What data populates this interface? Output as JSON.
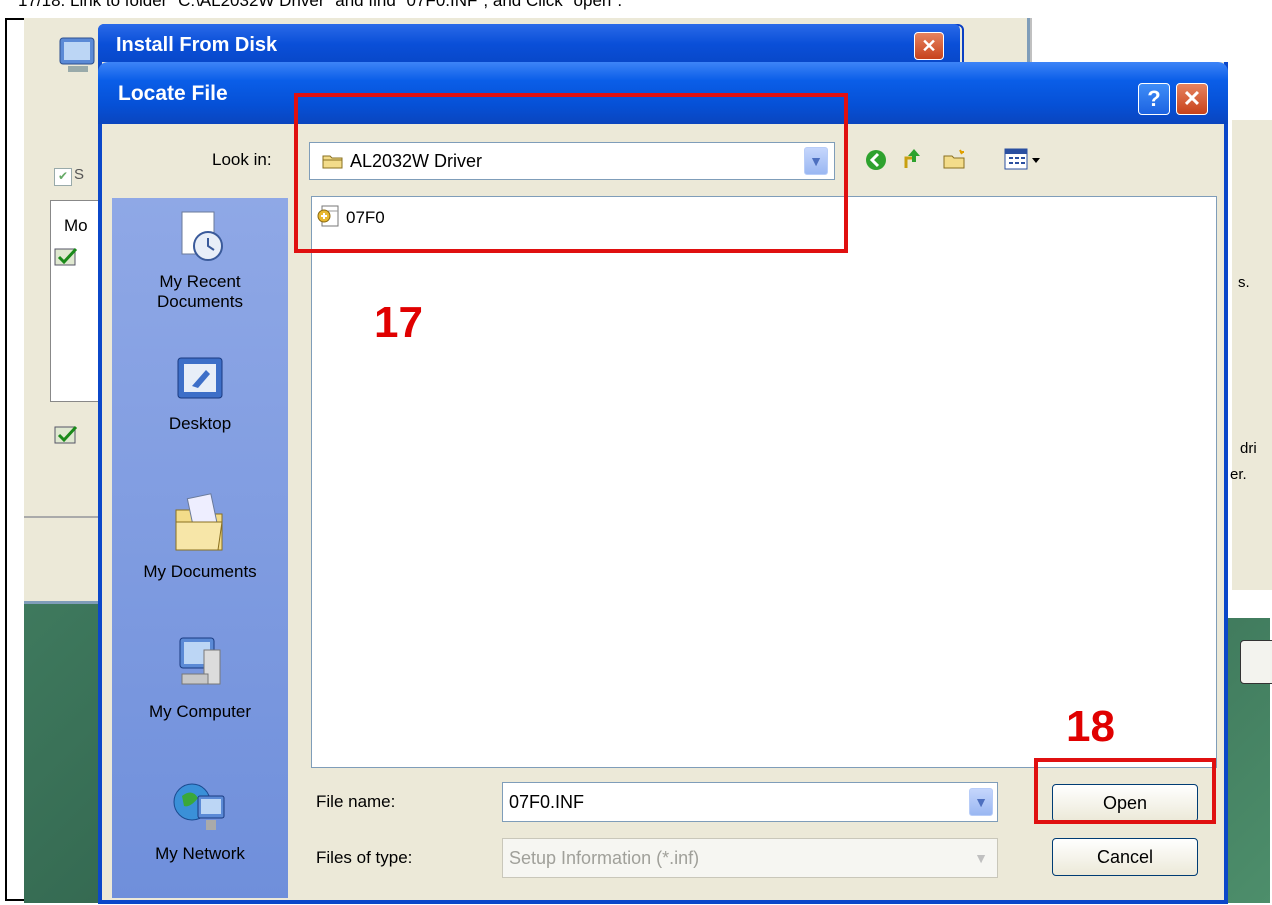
{
  "caption": "17/18. Link to folder \"C:\\AL2032W Driver\" and find \"07F0.INF\", and Click \"open\".",
  "background": {
    "wizard_checkbox_fragment": "S",
    "wizard_list_header_fragment": "Mo",
    "right_text_1": "s.",
    "right_text_2": "dri",
    "right_text_3": "er."
  },
  "install_from_disk": {
    "title": "Install From Disk"
  },
  "dialog": {
    "title": "Locate File",
    "look_in_label": "Look in:",
    "look_in_value": "AL2032W Driver",
    "places": [
      {
        "label": "My Recent Documents"
      },
      {
        "label": "Desktop"
      },
      {
        "label": "My Documents"
      },
      {
        "label": "My Computer"
      },
      {
        "label": "My Network"
      }
    ],
    "files": [
      {
        "name": "07F0"
      }
    ],
    "file_name_label": "File name:",
    "file_name_value": "07F0.INF",
    "file_type_label": "Files of type:",
    "file_type_value": "Setup Information (*.inf)",
    "open_label": "Open",
    "cancel_label": "Cancel",
    "help_symbol": "?",
    "close_symbol": "✕"
  },
  "annotations": {
    "step_a": "17",
    "step_b": "18"
  },
  "colors": {
    "title_blue": "#0650d6",
    "annotation_red": "#e00000",
    "dialog_bg": "#ece9d8"
  }
}
